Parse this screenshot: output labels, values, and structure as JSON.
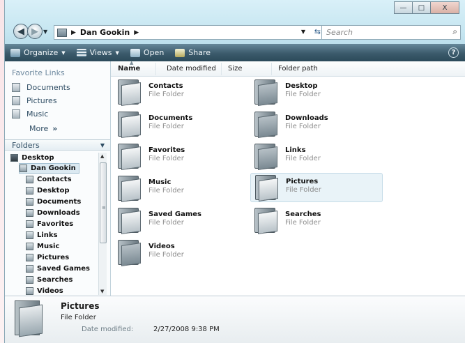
{
  "window": {
    "caption": {
      "minimize": "—",
      "maximize": "□",
      "close": "X"
    }
  },
  "address": {
    "crumbs": [
      "Dan Gookin"
    ],
    "search_placeholder": "Search"
  },
  "toolbar": {
    "organize": "Organize",
    "views": "Views",
    "open": "Open",
    "share": "Share",
    "help": "?"
  },
  "left": {
    "favorites_title": "Favorite Links",
    "favorites": [
      "Documents",
      "Pictures",
      "Music"
    ],
    "more": "More",
    "folders_label": "Folders",
    "tree": [
      {
        "label": "Desktop",
        "level": 0
      },
      {
        "label": "Dan Gookin",
        "level": 1,
        "selected": true
      },
      {
        "label": "Contacts",
        "level": 2
      },
      {
        "label": "Desktop",
        "level": 2
      },
      {
        "label": "Documents",
        "level": 2
      },
      {
        "label": "Downloads",
        "level": 2
      },
      {
        "label": "Favorites",
        "level": 2
      },
      {
        "label": "Links",
        "level": 2
      },
      {
        "label": "Music",
        "level": 2
      },
      {
        "label": "Pictures",
        "level": 2
      },
      {
        "label": "Saved Games",
        "level": 2
      },
      {
        "label": "Searches",
        "level": 2
      },
      {
        "label": "Videos",
        "level": 2
      }
    ]
  },
  "columns": [
    "Name",
    "Date modified",
    "Size",
    "Folder path"
  ],
  "items": [
    {
      "name": "Contacts",
      "type": "File Folder"
    },
    {
      "name": "Desktop",
      "type": "File Folder"
    },
    {
      "name": "Documents",
      "type": "File Folder"
    },
    {
      "name": "Downloads",
      "type": "File Folder"
    },
    {
      "name": "Favorites",
      "type": "File Folder"
    },
    {
      "name": "Links",
      "type": "File Folder"
    },
    {
      "name": "Music",
      "type": "File Folder"
    },
    {
      "name": "Pictures",
      "type": "File Folder",
      "selected": true
    },
    {
      "name": "Saved Games",
      "type": "File Folder"
    },
    {
      "name": "Searches",
      "type": "File Folder"
    },
    {
      "name": "Videos",
      "type": "File Folder"
    }
  ],
  "details": {
    "name": "Pictures",
    "type": "File Folder",
    "date_label": "Date modified:",
    "date_value": "2/27/2008 9:38 PM"
  }
}
